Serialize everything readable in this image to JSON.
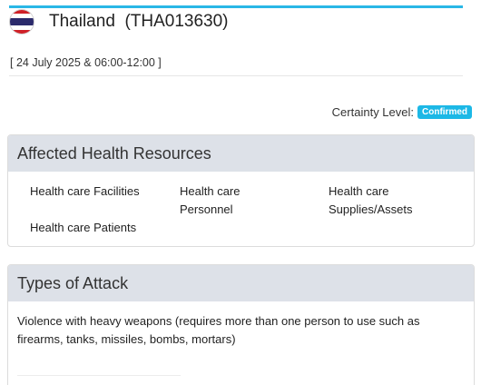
{
  "header": {
    "country": "Thailand",
    "code": "(THA013630)"
  },
  "date_range": "[ 24 July 2025 & 06:00-12:00 ]",
  "certainty": {
    "label": "Certainty Level:",
    "value": "Confirmed"
  },
  "affected_resources": {
    "title": "Affected Health Resources",
    "items": [
      "Health care Facilities",
      "Health care Personnel",
      "Health care Supplies/Assets",
      "Health care Patients"
    ]
  },
  "types_of_attack": {
    "title": "Types of Attack",
    "description": "Violence with heavy weapons (requires more than one person to use such as firearms, tanks, missiles, bombs, mortars)"
  },
  "colors": {
    "accent": "#2ab7e6",
    "badge": "#1cb8e6",
    "panel_header": "#dde1e8"
  },
  "icons": {
    "flag": "thailand-flag-icon"
  }
}
